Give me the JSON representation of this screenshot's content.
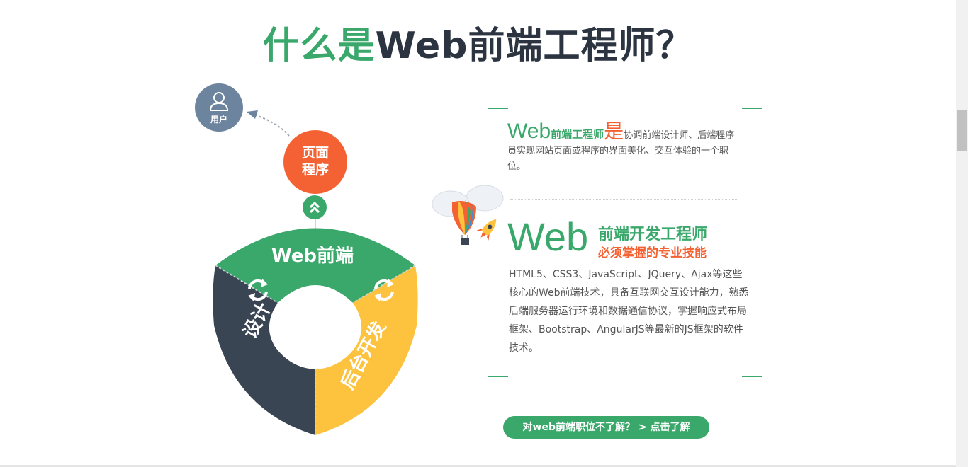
{
  "title": {
    "green": "什么是",
    "dark": "Web前端工程师？"
  },
  "diagram": {
    "user_label": "用户",
    "orange_line1": "页面",
    "orange_line2": "程序",
    "ring_top": "Web前端",
    "ring_left": "设计",
    "ring_right": "后台开发"
  },
  "info": {
    "p1_big": "Web",
    "p1_mid": "前端工程师",
    "p1_is": "是",
    "p1_text": "协调前端设计师、后端程序员实现网站页面或程序的界面美化、交互体验的一个职位。",
    "web_big": "Web",
    "h_green": "前端开发工程师",
    "h_orange": "必须掌握的专业技能",
    "p2": "HTML5、CSS3、JavaScript、JQuery、Ajax等这些核心的Web前端技术，具备互联网交互设计能力，熟悉后端服务器运行环境和数据通信协议，掌握响应式布局框架、Bootstrap、AngularJS等最新的JS框架的软件技术。"
  },
  "cta": {
    "label": "对web前端职位不了解？  > 点击了解"
  },
  "colors": {
    "green": "#3aa86b",
    "dark": "#3a4553",
    "orange": "#f46233",
    "yellow": "#fdc23e",
    "slate": "#6d849e"
  },
  "icons": [
    "user-icon",
    "double-chevron-up-icon",
    "refresh-arrows-icon",
    "hot-air-balloon-icon",
    "rocket-icon",
    "cloud-icon"
  ]
}
